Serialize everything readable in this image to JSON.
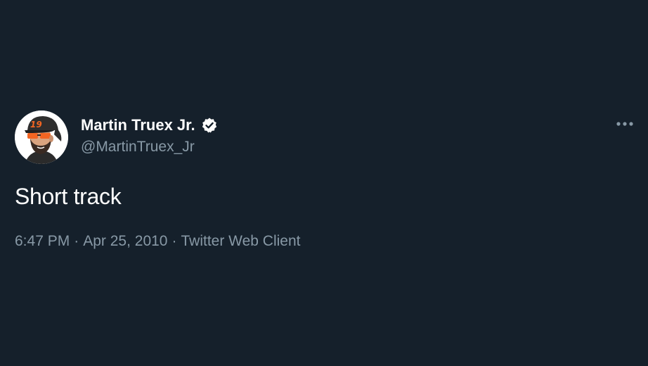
{
  "tweet": {
    "author": {
      "display_name": "Martin Truex Jr.",
      "handle": "@MartinTruex_Jr",
      "verified": true,
      "avatar_icon": "cartoon-driver-avatar-icon",
      "avatar_cap_number": "19"
    },
    "text": "Short track",
    "time": "6:47 PM",
    "date": "Apr 25, 2010",
    "source": "Twitter Web Client",
    "separator": "·",
    "more_icon": "more-horizontal-icon"
  },
  "colors": {
    "background": "#15202b",
    "primary_text": "#ffffff",
    "secondary_text": "#8899a6",
    "cap_accent": "#f26522",
    "verified_badge": "#ffffff"
  }
}
